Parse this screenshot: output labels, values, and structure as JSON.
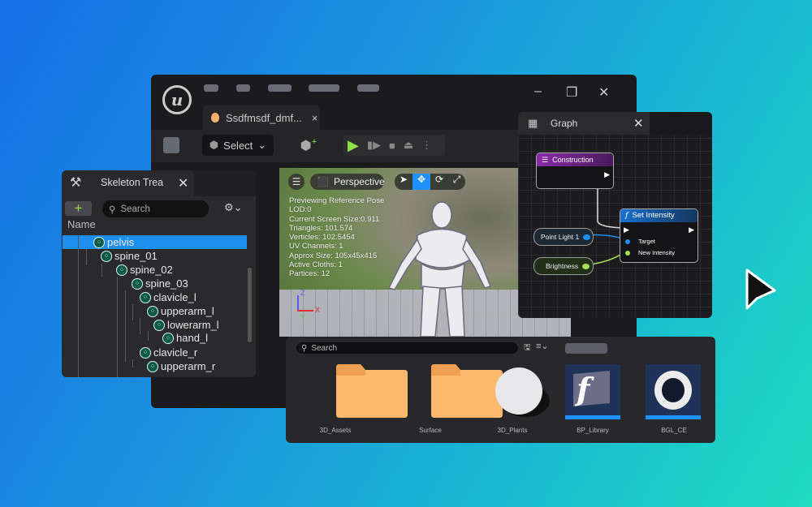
{
  "main_window": {
    "tab": {
      "title": "Ssdfmsdf_dmf...",
      "close": "×"
    },
    "toolbar": {
      "select_label": "Select"
    },
    "window_controls": {
      "minimize": "–",
      "restore": "❐",
      "close": "✕"
    }
  },
  "viewport": {
    "mode_label": "Perspective",
    "stats": [
      "Previewing Reference Pose",
      "LOD:0",
      "Current Screen Size:0.911",
      "Triangles: 101.574",
      "Verticles: 102.5454",
      "UV Channels: 1",
      "Approx Size: 105x45x415",
      "Active Cloths: 1",
      "Partices: 12"
    ],
    "axes": {
      "z": "Z",
      "x": "X",
      "y": "Y"
    }
  },
  "skeleton_panel": {
    "title": "Skeleton Trea",
    "search_placeholder": "Search",
    "column_header": "Name",
    "bones": [
      {
        "name": "pelvis",
        "selected": true
      },
      {
        "name": "spine_01"
      },
      {
        "name": "spine_02"
      },
      {
        "name": "spine_03"
      },
      {
        "name": "clavicle_l"
      },
      {
        "name": "upperarm_l"
      },
      {
        "name": "lowerarm_l"
      },
      {
        "name": "hand_l"
      },
      {
        "name": "clavicle_r"
      },
      {
        "name": "upperarm_r"
      }
    ]
  },
  "graph_panel": {
    "title": "Graph",
    "nodes": {
      "construction": "Construction",
      "set_intensity": "Set Intensity",
      "target": "Target",
      "new_intensity": "New Intensity",
      "point_light": "Point Light 1",
      "brightness": "Brightness"
    }
  },
  "content_browser": {
    "search_placeholder": "Search",
    "assets": [
      {
        "name": "3D_Assets",
        "icon": "folder"
      },
      {
        "name": "Surface",
        "icon": "folder"
      },
      {
        "name": "3D_Plants",
        "icon": "sphere"
      },
      {
        "name": "BP_Library",
        "icon": "function-library"
      },
      {
        "name": "BGL_CE",
        "icon": "torus"
      }
    ]
  },
  "colors": {
    "accent_blue": "#1e90ff",
    "play_green": "#8fe34a",
    "selection": "#1e8ff0",
    "construction": "#8a2aa8",
    "folder": "#fdb96e"
  }
}
